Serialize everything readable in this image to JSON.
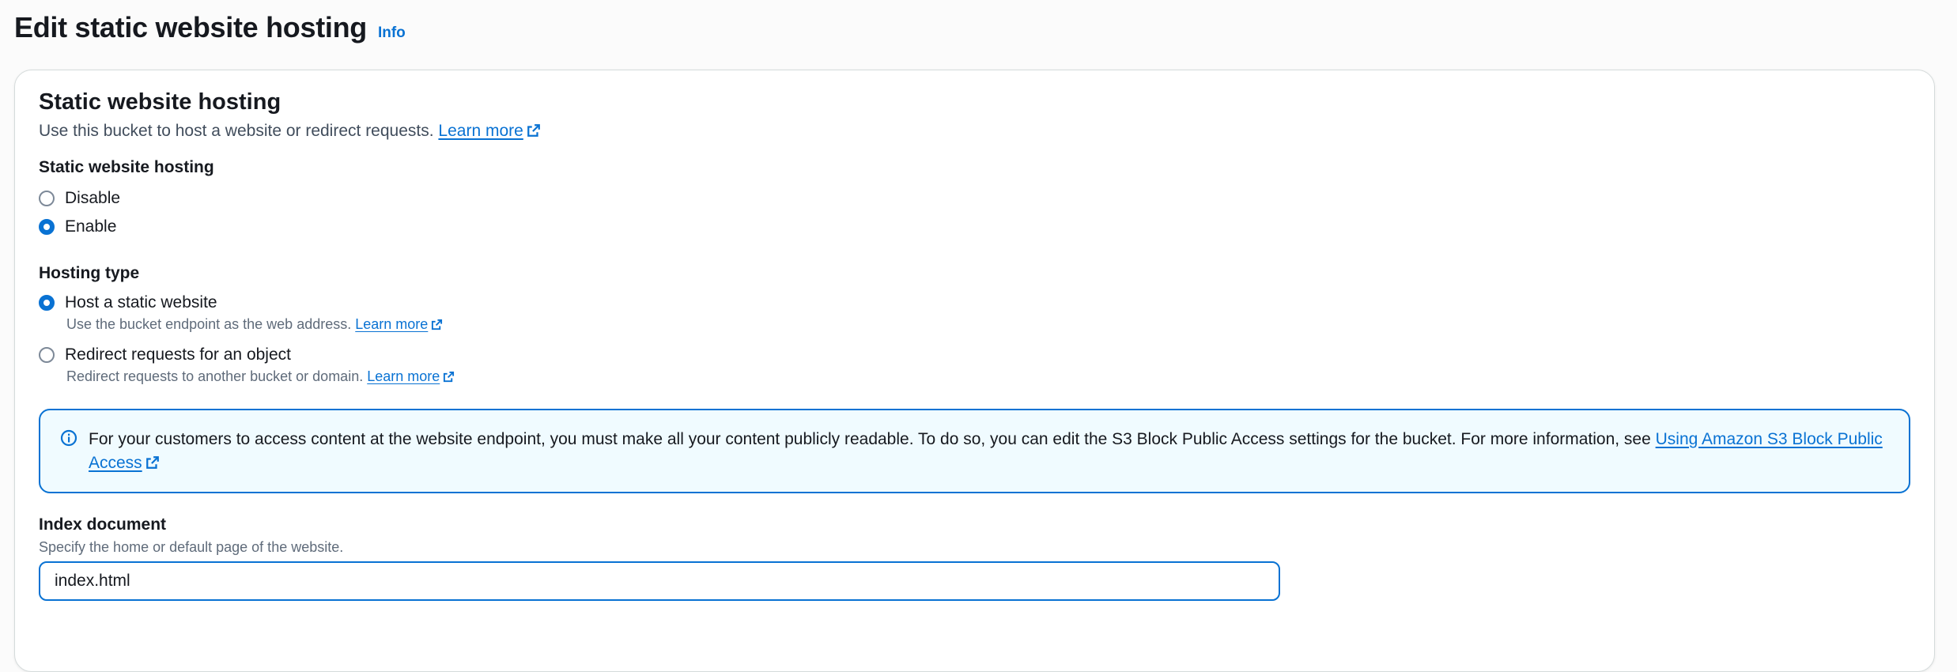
{
  "page": {
    "title": "Edit static website hosting",
    "info_label": "Info"
  },
  "section": {
    "title": "Static website hosting",
    "description": "Use this bucket to host a website or redirect requests.",
    "learn_more": "Learn more"
  },
  "hosting_toggle": {
    "label": "Static website hosting",
    "options": [
      {
        "label": "Disable",
        "checked": false
      },
      {
        "label": "Enable",
        "checked": true
      }
    ]
  },
  "hosting_type": {
    "label": "Hosting type",
    "options": [
      {
        "label": "Host a static website",
        "description": "Use the bucket endpoint as the web address.",
        "learn_more": "Learn more",
        "checked": true
      },
      {
        "label": "Redirect requests for an object",
        "description": "Redirect requests to another bucket or domain.",
        "learn_more": "Learn more",
        "checked": false
      }
    ]
  },
  "alert": {
    "text": "For your customers to access content at the website endpoint, you must make all your content publicly readable. To do so, you can edit the S3 Block Public Access settings for the bucket. For more information, see",
    "link": "Using Amazon S3 Block Public Access"
  },
  "index_document": {
    "label": "Index document",
    "description": "Specify the home or default page of the website.",
    "value": "index.html"
  },
  "colors": {
    "accent": "#0972d3",
    "alert_background": "#f0fbff",
    "text": "#16191f"
  }
}
